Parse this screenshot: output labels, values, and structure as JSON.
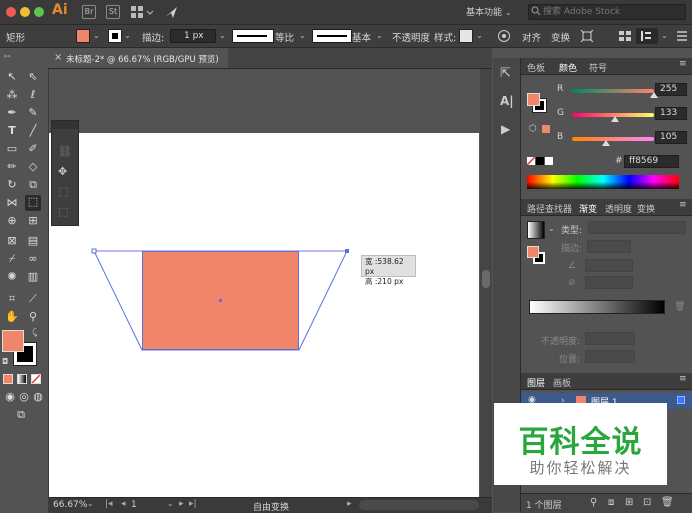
{
  "app": {
    "name": "Ai"
  },
  "titlebar": {
    "workspace": "基本功能",
    "search_placeholder": "搜索 Adobe Stock",
    "br_icon": "Br",
    "st_icon": "St"
  },
  "controlbar": {
    "shape_label": "矩形",
    "stroke_label": "描边:",
    "stroke_weight": "1 px",
    "profile_label": "等比",
    "brush_label": "基本",
    "opacity_label": "不透明度",
    "style_label": "样式:",
    "align_label": "对齐",
    "transform_label": "变换"
  },
  "document": {
    "tab_title": "未标题-2* @ 66.67% (RGB/GPU 预览)",
    "close_glyph": "×"
  },
  "tooltip": {
    "width": "宽 :538.62 px",
    "height": "高 :210 px"
  },
  "statusbar": {
    "zoom": "66.67%",
    "artboard_num": "1",
    "mode": "自由变换"
  },
  "color_panel": {
    "tabs": [
      "色板",
      "颜色",
      "符号"
    ],
    "active_tab": "颜色",
    "r_label": "R",
    "g_label": "G",
    "b_label": "B",
    "r": 255,
    "g": 133,
    "b": 105,
    "r_value": "255",
    "g_value": "133",
    "b_value": "105",
    "hex_prefix": "#",
    "hex": "ff8569"
  },
  "gradient_panel": {
    "tabs": [
      "路径查找器",
      "渐变",
      "透明度",
      "变换"
    ],
    "active_tab": "渐变",
    "type_label": "类型:",
    "stroke_label": "描边:",
    "opacity_label": "不透明度:",
    "position_label": "位置:"
  },
  "layers_panel": {
    "tabs": [
      "图层",
      "画板"
    ],
    "layer_name": "图层 1",
    "footer": "1 个图层"
  },
  "colors": {
    "fill": "#f08569",
    "selection": "#5b6fe0",
    "ui_bg": "#535353"
  },
  "watermark": {
    "title": "百科全说",
    "subtitle": "助你轻松解决"
  }
}
